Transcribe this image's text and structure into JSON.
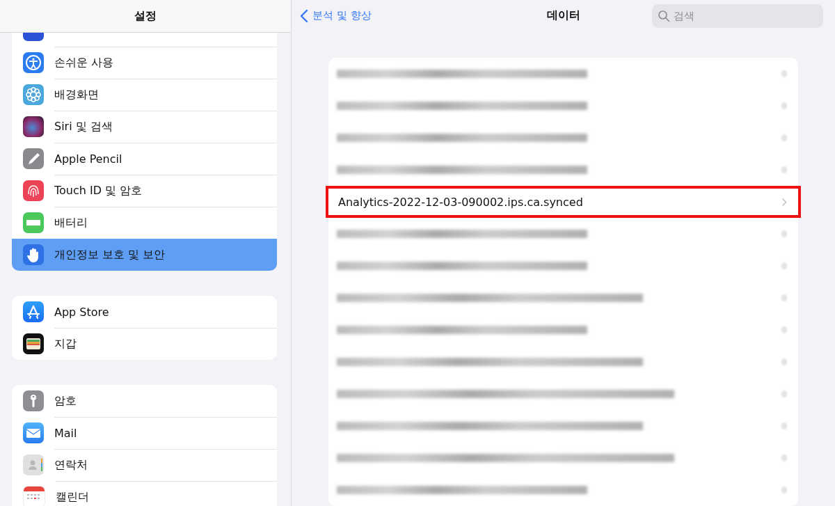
{
  "sidebar": {
    "title": "설정",
    "groups": [
      [
        {
          "kind": "cutoff"
        },
        {
          "kind": "accessibility",
          "label": "손쉬운 사용",
          "selected": false
        },
        {
          "kind": "wallpaper",
          "label": "배경화면",
          "selected": false
        },
        {
          "kind": "siri",
          "label": "Siri 및 검색",
          "selected": false
        },
        {
          "kind": "pencil",
          "label": "Apple Pencil",
          "selected": false
        },
        {
          "kind": "touchid",
          "label": "Touch ID 및 암호",
          "selected": false
        },
        {
          "kind": "battery",
          "label": "배터리",
          "selected": false
        },
        {
          "kind": "privacy",
          "label": "개인정보 보호 및 보안",
          "selected": true
        }
      ],
      [
        {
          "kind": "appstore",
          "label": "App Store",
          "selected": false
        },
        {
          "kind": "wallet",
          "label": "지갑",
          "selected": false
        }
      ],
      [
        {
          "kind": "passwords",
          "label": "암호",
          "selected": false
        },
        {
          "kind": "mail",
          "label": "Mail",
          "selected": false
        },
        {
          "kind": "contacts",
          "label": "연락처",
          "selected": false
        },
        {
          "kind": "calendar",
          "label": "캘린더",
          "selected": false
        }
      ]
    ]
  },
  "detail": {
    "back": "분석 및 향상",
    "title": "데이터",
    "search": {
      "placeholder": "검색"
    },
    "rows": [
      {
        "kind": "short"
      },
      {
        "kind": "short"
      },
      {
        "kind": "short"
      },
      {
        "kind": "short"
      },
      {
        "kind": "file",
        "name": "Analytics-2022-12-03-090002.ips.ca.synced",
        "highlighted": true
      },
      {
        "kind": "short"
      },
      {
        "kind": "short"
      },
      {
        "kind": "long"
      },
      {
        "kind": "short"
      },
      {
        "kind": "long"
      },
      {
        "kind": "longer"
      },
      {
        "kind": "long"
      },
      {
        "kind": "longer"
      },
      {
        "kind": "short"
      }
    ]
  }
}
